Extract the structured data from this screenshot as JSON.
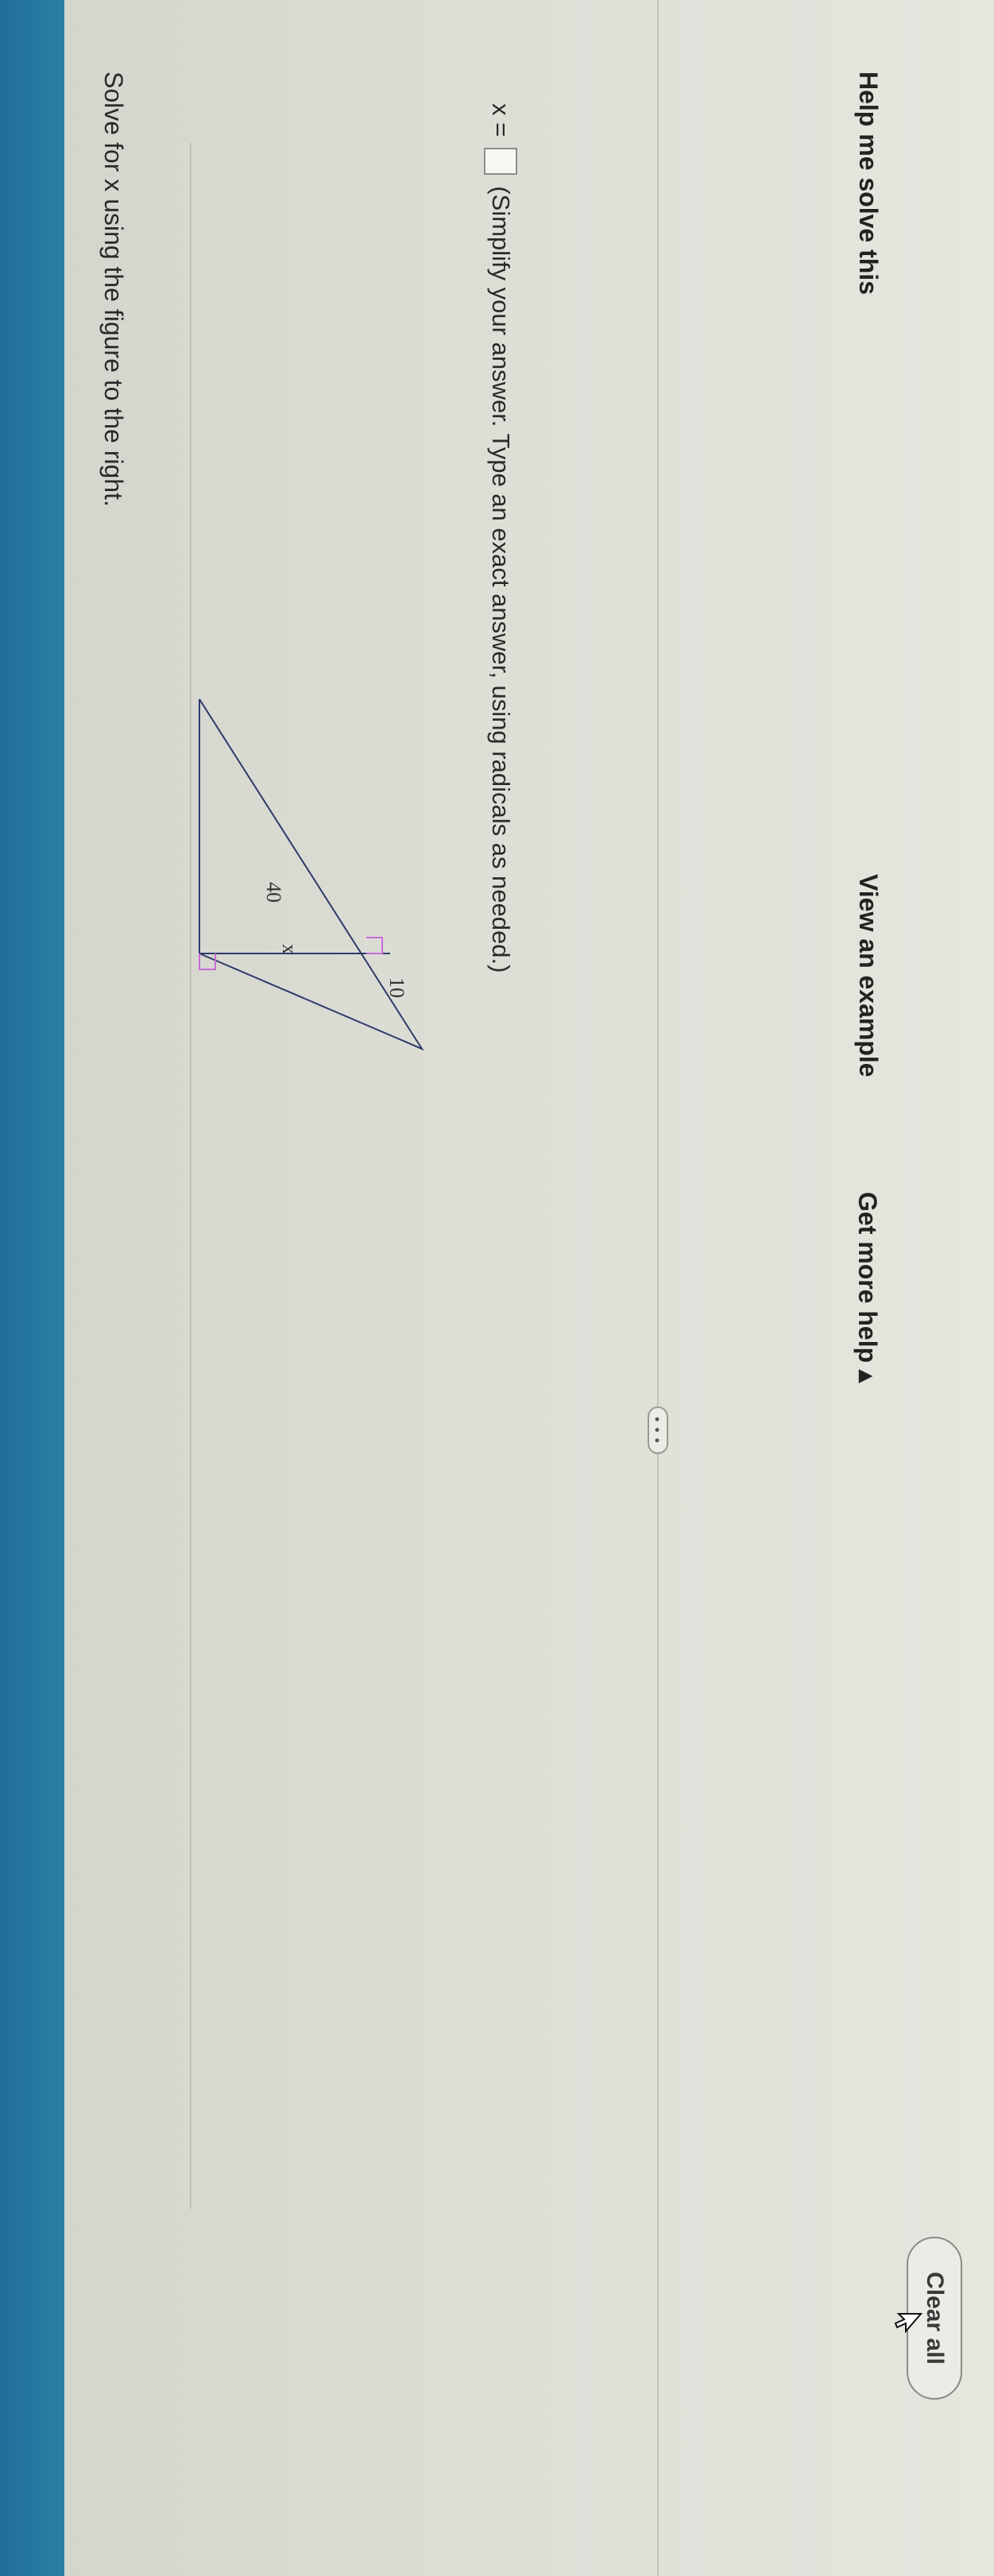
{
  "question": {
    "text": "Solve for x using the figure to the right."
  },
  "figure": {
    "label_40": "40",
    "label_x": "x",
    "label_10": "10"
  },
  "answer": {
    "prefix": "x =",
    "value": "",
    "instruction": "(Simplify your answer. Type an exact answer, using radicals as needed.)"
  },
  "more_button": {
    "label": "• • •"
  },
  "help": {
    "solve_label": "Help me solve this",
    "example_label": "View an example",
    "more_help_label": "Get more help ▴",
    "clear_label": "Clear all"
  },
  "colors": {
    "top_bar": "#2d7fa6",
    "right_angle_marker": "#c66bd8"
  }
}
